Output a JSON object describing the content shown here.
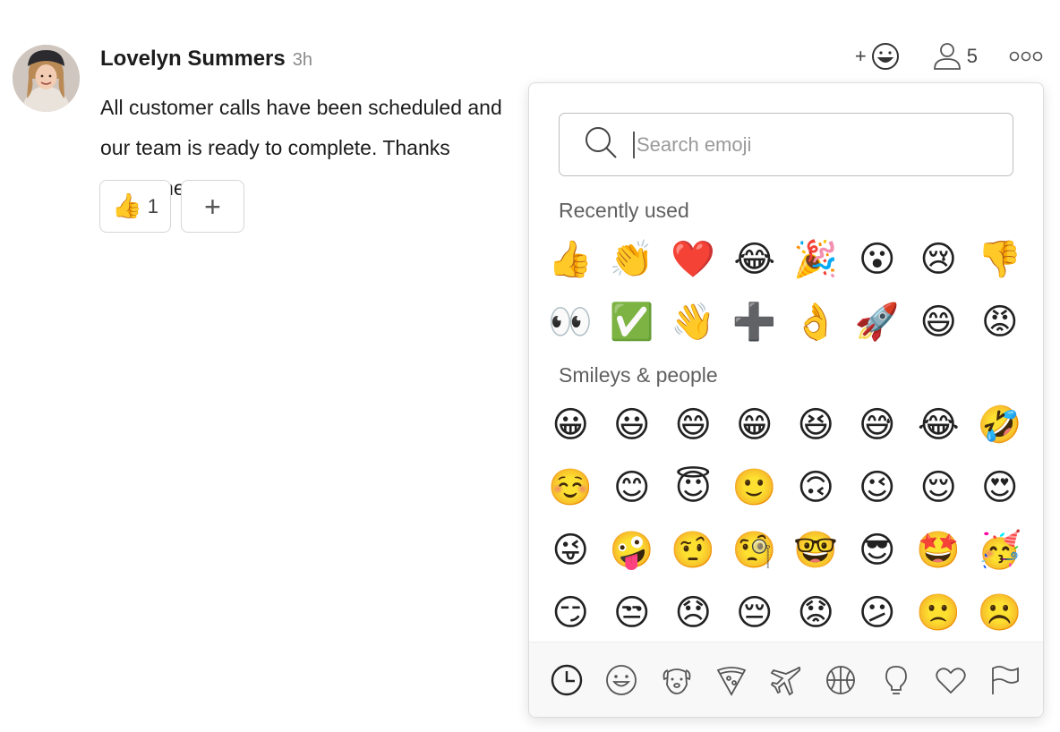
{
  "message": {
    "author": "Lovelyn Summers",
    "timestamp": "3h",
    "text": "All customer calls have been scheduled and our team is ready to complete. Thanks everyone!",
    "reactions": [
      {
        "emoji": "👍",
        "count": "1"
      }
    ],
    "add_reaction_glyph": "+"
  },
  "top_actions": {
    "add_reaction_label": "+",
    "followers_count": "5"
  },
  "picker": {
    "search_placeholder": "Search emoji",
    "recent_label": "Recently used",
    "smileys_label": "Smileys & people",
    "recent": [
      "👍",
      "👏",
      "❤️",
      "😂",
      "🎉",
      "😮",
      "😢",
      "👎",
      "👀",
      "✅",
      "👋",
      "➕",
      "👌",
      "🚀",
      "😄",
      "😡"
    ],
    "smileys": [
      "😀",
      "😃",
      "😄",
      "😁",
      "😆",
      "😅",
      "😂",
      "🤣",
      "☺️",
      "😊",
      "😇",
      "🙂",
      "🙃",
      "😉",
      "😌",
      "😍",
      "😜",
      "🤪",
      "🤨",
      "🧐",
      "🤓",
      "😎",
      "🤩",
      "🥳",
      "😏",
      "😒",
      "😞",
      "😔",
      "😟",
      "😕",
      "🙁",
      "☹️"
    ],
    "categories": [
      "clock-icon",
      "smiley-icon",
      "dog-icon",
      "pizza-icon",
      "plane-icon",
      "basketball-icon",
      "lightbulb-icon",
      "heart-icon",
      "flag-icon"
    ]
  }
}
